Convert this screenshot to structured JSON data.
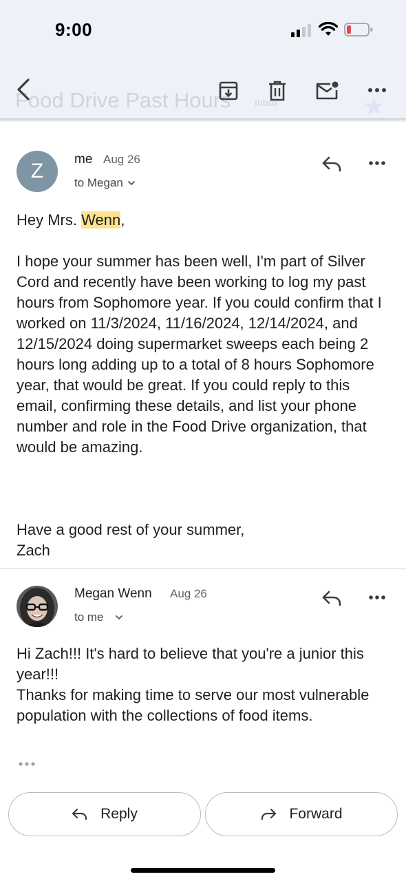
{
  "status_bar": {
    "time": "9:00"
  },
  "header": {
    "subject": "Food Drive Past Hours",
    "label_badge": "Inbox",
    "icons": [
      "back-icon",
      "archive-icon",
      "delete-icon",
      "mark-unread-icon",
      "more-icon",
      "star-icon"
    ]
  },
  "messages": [
    {
      "avatar_letter": "Z",
      "avatar_color": "#7e95a4",
      "sender": "me",
      "date": "Aug 26",
      "to": "to Megan",
      "greeting_pre": "Hey Mrs. ",
      "greeting_highlight": "Wenn",
      "greeting_post": ",",
      "paragraph": "I hope your summer has been well, I'm part of Silver Cord and recently have been working to log my past hours from Sophomore year. If you could confirm that I worked on 11/3/2024, 11/16/2024, 12/14/2024, and 12/15/2024 doing supermarket sweeps each being 2 hours long adding up to a total of 8 hours Sophomore year, that would be great. If you could reply to this email, confirming these details, and list your phone number and role in the Food Drive organization, that would be amazing.",
      "closing": "Have a good rest of your summer,",
      "signature": "Zach"
    },
    {
      "sender": "Megan Wenn",
      "date": "Aug 26",
      "to": "to me",
      "line1": "Hi Zach!!!  It's hard to believe that you're a junior this year!!!",
      "line2": "Thanks for making time to serve our most vulnerable population with the collections of food items."
    }
  ],
  "actions": {
    "reply_label": "Reply",
    "forward_label": "Forward"
  },
  "colors": {
    "header_bg": "#eef1f8",
    "highlight": "#fde28f",
    "battery_low": "#e5484d"
  }
}
